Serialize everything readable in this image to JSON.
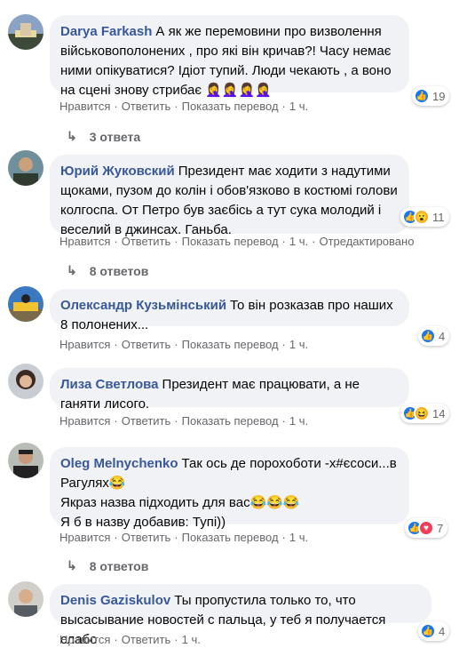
{
  "comments": [
    {
      "author": "Darya Farkash",
      "text": "А як же перемовини про визволення військовополонених , про які він кричав?! Часу немає ними опікуватися? Ідіот тупий. Люди чекають , а воно на сцені знову стрибає",
      "emojis": "🤦‍♀️🤦‍♀️🤦‍♀️🤦‍♀️",
      "reactions": {
        "count": "19"
      },
      "actions": {
        "like": "Нравится",
        "reply": "Ответить",
        "translate": "Показать перевод",
        "time": "1 ч."
      },
      "replies": "3 ответа"
    },
    {
      "author": "Юрий Жуковский",
      "text": "Президент має ходити з надутими щоками, пузом до колін і обов'язково в костюмі голови колгоспа. От Петро був заєбісь а тут сука молодий і веселий в джинсах. Ганьба.",
      "reactions": {
        "count": "11"
      },
      "actions": {
        "like": "Нравится",
        "reply": "Ответить",
        "translate": "Показать перевод",
        "time": "1 ч.",
        "edited": "Отредактировано"
      },
      "replies": "8 ответов"
    },
    {
      "author": "Олександр Кузьмінський",
      "text": "То він розказав про наших 8 полонених...",
      "reactions": {
        "count": "4"
      },
      "actions": {
        "like": "Нравится",
        "reply": "Ответить",
        "translate": "Показать перевод",
        "time": "1 ч."
      }
    },
    {
      "author": "Лиза Светлова",
      "text": "Президент має працювати, а не ганяти лисого.",
      "reactions": {
        "count": "14"
      },
      "actions": {
        "like": "Нравится",
        "reply": "Ответить",
        "translate": "Показать перевод",
        "time": "1 ч."
      }
    },
    {
      "author": "Oleg Melnychenko",
      "text1": "Так ось де порохоботи -х#єсоси...в Рагулях",
      "text2": "Якраз назва підходить для вас",
      "text3": "Я б в назву добавив: Тупі))",
      "reactions": {
        "count": "7"
      },
      "actions": {
        "like": "Нравится",
        "reply": "Ответить",
        "translate": "Показать перевод",
        "time": "1 ч."
      },
      "replies": "8 ответов"
    },
    {
      "author": "Denis Gaziskulov",
      "text": "Ты пропустила только то, что высасывание новостей с пальца, у теб я получается слабо",
      "reactions": {
        "count": "4"
      },
      "actions": {
        "like": "Нравится",
        "reply": "Ответить",
        "time": "1 ч."
      }
    }
  ],
  "colors": {
    "author": "#385898",
    "bubble": "#f0f2f5",
    "meta": "#65676b",
    "like": "#1877f2"
  }
}
